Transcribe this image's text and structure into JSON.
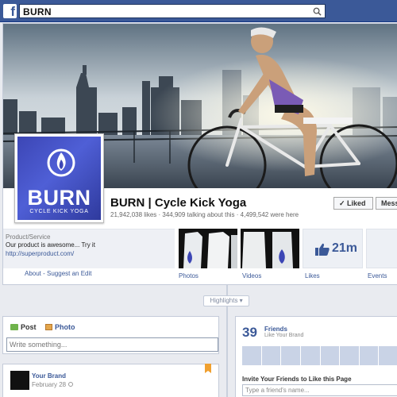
{
  "topbar": {
    "logo": "f",
    "search_value": "BURN",
    "brand_color": "#3b5998",
    "search_icon": "search-icon"
  },
  "page": {
    "name": "BURN | Cycle Kick Yoga",
    "stats": "21,942,038 likes · 344,909 talking about this · 4,499,542 were here",
    "profile": {
      "logo_word": "BURN",
      "logo_tagline": "CYCLE KICK YOGA",
      "logo_icon": "flame-icon"
    },
    "buttons": {
      "liked": "Liked",
      "message": "Mess"
    },
    "about": {
      "category": "Product/Service",
      "description": "Our product is awesome... Try it",
      "link": "http://superproduct.com/",
      "footer": "About - Suggest an Edit"
    },
    "apps": [
      {
        "label": "Photos"
      },
      {
        "label": "Videos"
      },
      {
        "label": "Likes",
        "count": "21m"
      },
      {
        "label": "Events"
      }
    ]
  },
  "timeline": {
    "highlights_label": "Highlights ▾"
  },
  "composer": {
    "post_tab": "Post",
    "photo_tab": "Photo",
    "placeholder": "Write something..."
  },
  "post": {
    "author": "Your Brand",
    "date": "February 28"
  },
  "friends": {
    "count": "39",
    "title": "Friends",
    "subtitle": "Like Your Brand",
    "invite_title": "Invite Your Friends to Like this Page",
    "invite_placeholder": "Type a friend's name..."
  }
}
